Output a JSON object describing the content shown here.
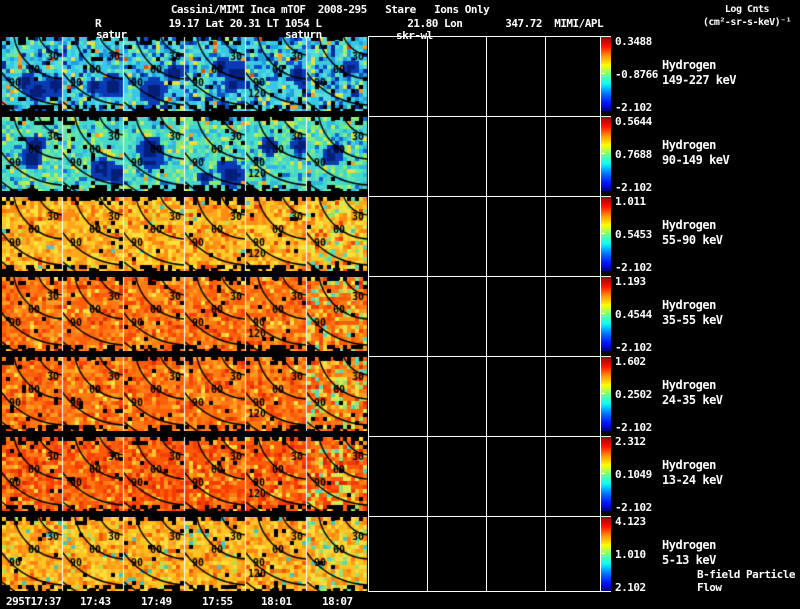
{
  "header": {
    "title": "Cassini/MIMI Inca mTOF  2008-295   Stare   Ions Only",
    "units_line1": "Log Cnts",
    "units_line2": "(cm²-sr-s-keV)⁻¹",
    "info_line": "R           19.17 Lat 20.31 LT 1054 L              21.80 Lon       347.72  MIMI/APL"
  },
  "overlay_labels": [
    "satur",
    "saturn",
    "skr-wl"
  ],
  "chart_data": {
    "type": "heatmap",
    "title": "Cassini/MIMI Inca mTOF 2008-295 Stare Ions Only",
    "units": "Log Cnts (cm²-sr-s-keV)⁻¹",
    "rows": [
      {
        "species": "Hydrogen",
        "energy": "149-227 keV",
        "scale_max": "0.3488",
        "scale_mid": "-0.8766",
        "scale_min": "-2.102",
        "palette": "cold1"
      },
      {
        "species": "Hydrogen",
        "energy": "90-149 keV",
        "scale_max": "0.5644",
        "scale_mid": "0.7688",
        "scale_min": "-2.102",
        "palette": "cold2"
      },
      {
        "species": "Hydrogen",
        "energy": "55-90 keV",
        "scale_max": "1.011",
        "scale_mid": "0.5453",
        "scale_min": "-2.102",
        "palette": "warm1"
      },
      {
        "species": "Hydrogen",
        "energy": "35-55 keV",
        "scale_max": "1.193",
        "scale_mid": "0.4544",
        "scale_min": "-2.102",
        "palette": "hot1"
      },
      {
        "species": "Hydrogen",
        "energy": "24-35 keV",
        "scale_max": "1.602",
        "scale_mid": "0.2502",
        "scale_min": "-2.102",
        "palette": "hot1"
      },
      {
        "species": "Hydrogen",
        "energy": "13-24 keV",
        "scale_max": "2.312",
        "scale_mid": "0.1049",
        "scale_min": "-2.102",
        "palette": "hot2"
      },
      {
        "species": "Hydrogen",
        "energy": "5-13 keV",
        "scale_max": "4.123",
        "scale_mid": "1.010",
        "scale_min": "2.102",
        "palette": "warm2",
        "extra_label": "B-field Particle Flow"
      }
    ],
    "contour_labels": [
      "30",
      "60",
      "90",
      "120"
    ],
    "time_ticks": [
      "295T17:37",
      "17:43",
      "17:49",
      "17:55",
      "18:01",
      "18:07"
    ],
    "colorbar_gradient": [
      "#9b0000",
      "#ff1000",
      "#ff9000",
      "#ffff00",
      "#80ff80",
      "#00ffff",
      "#0080ff",
      "#0018ff",
      "#000080"
    ],
    "palettes": {
      "cold1": [
        [
          "#38c8e6",
          30
        ],
        [
          "#52dcdc",
          18
        ],
        [
          "#20a0dc",
          12
        ],
        [
          "#0a50c8",
          8
        ],
        [
          "#062a96",
          7
        ],
        [
          "#6fe6a8",
          8
        ],
        [
          "#a8ee6e",
          4
        ],
        [
          "#e6e23c",
          3
        ],
        [
          "#f0a028",
          2
        ],
        [
          "#e05010",
          1
        ],
        [
          "#000000",
          4
        ]
      ],
      "cold2": [
        [
          "#44d8cc",
          28
        ],
        [
          "#5ee4b4",
          16
        ],
        [
          "#30b8dc",
          12
        ],
        [
          "#84ea7c",
          10
        ],
        [
          "#b4ee5a",
          5
        ],
        [
          "#e6e23c",
          4
        ],
        [
          "#1468cc",
          5
        ],
        [
          "#f0a028",
          1
        ],
        [
          "#000000",
          3
        ]
      ],
      "warm1": [
        [
          "#ffc928",
          24
        ],
        [
          "#ffa81e",
          20
        ],
        [
          "#ff8c14",
          14
        ],
        [
          "#ffe03c",
          10
        ],
        [
          "#ff700c",
          6
        ],
        [
          "#f04008",
          3
        ],
        [
          "#c8e242",
          2
        ],
        [
          "#50c8b4",
          1
        ],
        [
          "#000000",
          2
        ]
      ],
      "hot1": [
        [
          "#ff7a12",
          24
        ],
        [
          "#ff5e0a",
          20
        ],
        [
          "#ff9a1e",
          14
        ],
        [
          "#f84406",
          10
        ],
        [
          "#ffc12c",
          5
        ],
        [
          "#e03004",
          3
        ],
        [
          "#ffe446",
          2
        ],
        [
          "#000000",
          2
        ]
      ],
      "hot2": [
        [
          "#ff5a08",
          26
        ],
        [
          "#f83c04",
          18
        ],
        [
          "#ff7c12",
          16
        ],
        [
          "#ff9e20",
          8
        ],
        [
          "#e02800",
          6
        ],
        [
          "#ffc22c",
          4
        ],
        [
          "#ffe034",
          2
        ],
        [
          "#000000",
          2
        ]
      ],
      "warm2": [
        [
          "#ffc524",
          24
        ],
        [
          "#ff9c18",
          18
        ],
        [
          "#ffdc3c",
          12
        ],
        [
          "#ff8310",
          12
        ],
        [
          "#ffb01e",
          10
        ],
        [
          "#f05808",
          4
        ],
        [
          "#b4e04c",
          2
        ],
        [
          "#46c8b4",
          2
        ],
        [
          "#000000",
          3
        ]
      ],
      "greenmix": [
        [
          "#d8ea50",
          10
        ],
        [
          "#9ae06e",
          8
        ],
        [
          "#5ad8b4",
          6
        ],
        [
          "#ffd83c",
          8
        ]
      ]
    }
  }
}
